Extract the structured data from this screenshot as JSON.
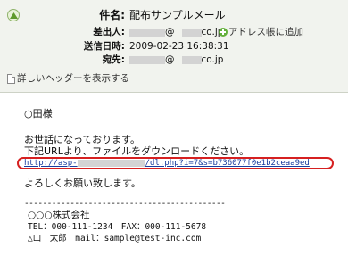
{
  "header": {
    "subject_label": "件名:",
    "subject_value": "配布サンプルメール",
    "from_label": "差出人:",
    "from_at": "@",
    "from_domain": "co.jp",
    "add_to_addressbook": "アドレス帳に追加",
    "date_label": "送信日時:",
    "date_value": "2009-02-23 16:38:31",
    "to_label": "宛先:",
    "to_at": "@",
    "to_domain": "co.jp",
    "show_details": "詳しいヘッダーを表示する"
  },
  "body": {
    "greeting": "○田様",
    "line1": "お世話になっております。",
    "line2": "下記URLより、ファイルをダウンロードください。",
    "url_prefix": "http://asp-",
    "url_suffix": "/dl.php?i=7&s=b736077f0e1b2ceaa9ed",
    "closing": "よろしくお願い致します。",
    "signature_separator": "--------------------------------------------",
    "sig_company": "○○○株式会社",
    "sig_phone": "TEL：000-111-1234　FAX：000-111-5678",
    "sig_person": "△山　太郎　mail：sample@test-inc.com"
  },
  "colors": {
    "header_bg": "#f1f3ee",
    "highlight_border": "#d62020",
    "link": "#1a3d9e",
    "add_icon": "#62b03a"
  },
  "icons": [
    "collapse-up-icon",
    "add-contact-icon",
    "document-icon"
  ]
}
